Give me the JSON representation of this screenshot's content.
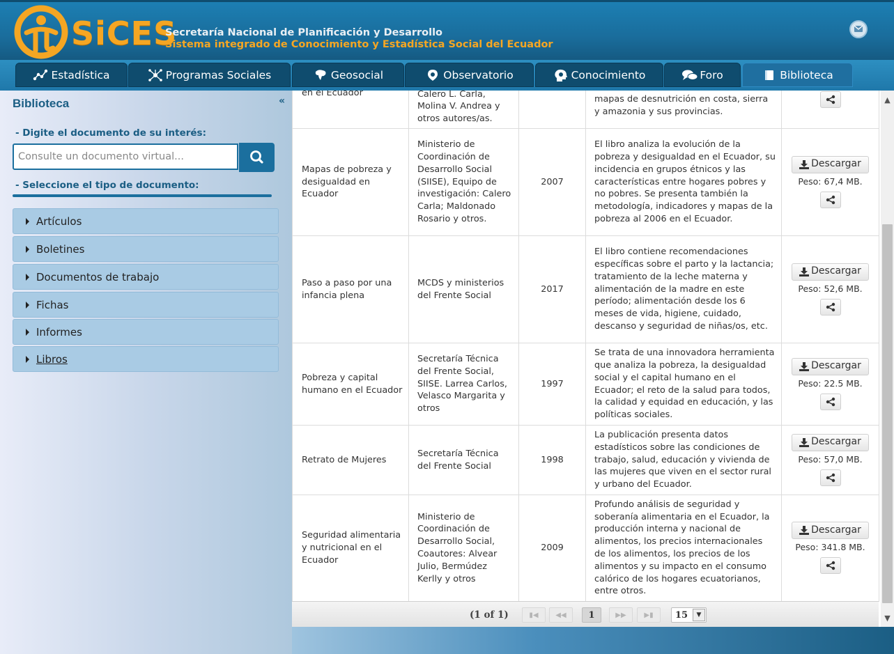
{
  "header": {
    "brand": "SiCES",
    "org_line1": "Secretaría Nacional de Planificación y Desarrollo",
    "org_line2": "Sistema integrado de Conocimiento y Estadística Social del Ecuador",
    "icons": {
      "logo": "sices-logo-icon",
      "mail": "mail-icon"
    }
  },
  "nav": {
    "items": [
      {
        "label": "Estadística",
        "icon": "network-nodes-icon"
      },
      {
        "label": "Programas Sociales",
        "icon": "hub-icon"
      },
      {
        "label": "Geosocial",
        "icon": "map-icon"
      },
      {
        "label": "Observatorio",
        "icon": "location-pin-icon"
      },
      {
        "label": "Conocimiento",
        "icon": "head-bulb-icon"
      },
      {
        "label": "Foro",
        "icon": "chat-bubbles-icon"
      },
      {
        "label": "Biblioteca",
        "icon": "book-icon"
      }
    ],
    "active": "Biblioteca"
  },
  "sidebar": {
    "title": "Biblioteca",
    "search_label": "- Digite el documento de su interés:",
    "search_placeholder": "Consulte un documento virtual...",
    "type_label": "- Seleccione el tipo de documento:",
    "categories": [
      "Artículos",
      "Boletines",
      "Documentos de trabajo",
      "Fichas",
      "Informes",
      "Libros"
    ]
  },
  "table": {
    "rows": [
      {
        "title": "en el Ecuador",
        "author": "Calero L. Carla, Molina V. Andrea y otros autores/as.",
        "year": "",
        "description": "mapas de desnutrición en costa, sierra y amazonia y sus provincias.",
        "download": "",
        "weight": ""
      },
      {
        "title": "Mapas de pobreza y desigualdad en Ecuador",
        "author": "Ministerio de Coordinación de Desarrollo Social (SIISE), Equipo de investigación: Calero Carla; Maldonado Rosario y otros.",
        "year": "2007",
        "description": "El libro analiza la evolución de la pobreza y desigualdad en el Ecuador, su incidencia en grupos étnicos y las características entre hogares pobres y no pobres. Se presenta también la metodología, indicadores y mapas de la pobreza al 2006 en el Ecuador.",
        "download": "Descargar",
        "weight": "Peso: 67,4 MB."
      },
      {
        "title": "Paso a paso por una infancia plena",
        "author": "MCDS y ministerios del Frente Social",
        "year": "2017",
        "description": "El libro contiene recomendaciones específicas sobre el parto y la lactancia; tratamiento de la leche materna y alimentación de la madre en este período; alimentación desde los 6 meses de vida, higiene, cuidado, descanso y seguridad de niñas/os, etc.",
        "download": "Descargar",
        "weight": "Peso: 52,6 MB."
      },
      {
        "title": "Pobreza y capital humano en el Ecuador",
        "author": "Secretaría Técnica del Frente Social, SIISE. Larrea Carlos, Velasco Margarita y otros",
        "year": "1997",
        "description": "Se trata de una innovadora herramienta que analiza la pobreza, la desigualdad social y el capital humano en el Ecuador; el reto de la salud para todos, la calidad y equidad en educación, y las políticas sociales.",
        "download": "Descargar",
        "weight": "Peso: 22.5 MB."
      },
      {
        "title": "Retrato de Mujeres",
        "author": "Secretaría Técnica del Frente Social",
        "year": "1998",
        "description": "La publicación presenta datos estadísticos sobre las condiciones de trabajo, salud, educación y vivienda de las mujeres que viven en el sector rural y urbano del Ecuador.",
        "download": "Descargar",
        "weight": "Peso: 57,0 MB."
      },
      {
        "title": "Seguridad alimentaria y nutricional en el Ecuador",
        "author": "Ministerio de Coordinación de Desarrollo Social, Coautores: Alvear Julio, Bermúdez Kerlly y otros",
        "year": "2009",
        "description": "Profundo análisis de seguridad y soberanía alimentaria en el Ecuador, la producción interna y nacional de alimentos, los precios internacionales de los alimentos, los precios de los alimentos y su impacto en el consumo calórico de los hogares ecuatorianos, entre otros.",
        "download": "Descargar",
        "weight": "Peso: 341.8 MB."
      }
    ]
  },
  "pager": {
    "status": "(1 of 1)",
    "current_page": "1",
    "rows_per_page": "15",
    "buttons": {
      "first": "first-page-icon",
      "prev": "prev-page-icon",
      "next": "next-page-icon",
      "last": "last-page-icon"
    }
  },
  "colors": {
    "brand_blue": "#1b6f9e",
    "brand_orange": "#f5a623",
    "nav_dark": "#0f4c6e"
  }
}
